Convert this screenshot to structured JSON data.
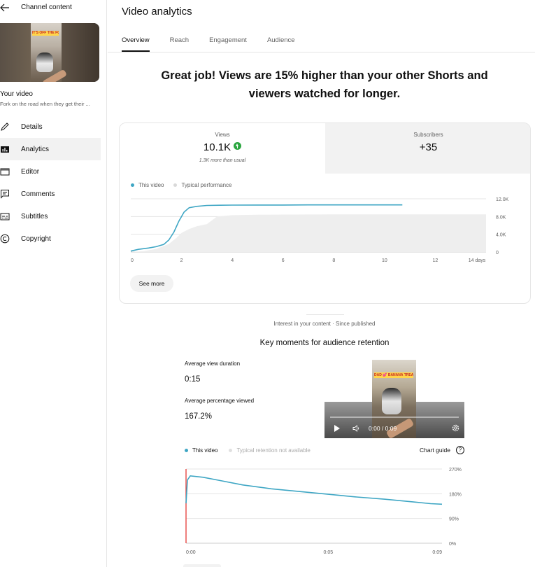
{
  "sidebar": {
    "title": "Channel content",
    "thumbnail_caption": "IT'S OFF THE FORK IN THE ROAD",
    "your_video_label": "Your video",
    "video_title": "Fork on the road when they get their ...",
    "items": [
      {
        "label": "Details",
        "icon": "pencil-icon"
      },
      {
        "label": "Analytics",
        "icon": "analytics-icon"
      },
      {
        "label": "Editor",
        "icon": "editor-icon"
      },
      {
        "label": "Comments",
        "icon": "comments-icon"
      },
      {
        "label": "Subtitles",
        "icon": "subtitles-icon"
      },
      {
        "label": "Copyright",
        "icon": "copyright-icon"
      }
    ],
    "active_item": "Analytics"
  },
  "header": {
    "title": "Video analytics",
    "tabs": [
      "Overview",
      "Reach",
      "Engagement",
      "Audience"
    ],
    "active_tab": "Overview"
  },
  "headline": {
    "line1": "Great job! Views are 15% higher than your other Shorts and",
    "line2": "viewers watched for longer."
  },
  "metrics": {
    "views": {
      "label": "Views",
      "value": "10.1K",
      "note": "1.3K more than usual"
    },
    "subscribers": {
      "label": "Subscribers",
      "value": "+35"
    }
  },
  "performance_chart": {
    "legend_this": "This video",
    "legend_typical": "Typical performance",
    "see_more": "See more"
  },
  "retention": {
    "interest_label": "Interest in your content · Since published",
    "title": "Key moments for audience retention",
    "avg_view_duration_label": "Average view duration",
    "avg_view_duration_value": "0:15",
    "avg_pct_label": "Average percentage viewed",
    "avg_pct_value": "167.2%",
    "legend_this": "This video",
    "legend_typical": "Typical retention not available",
    "chart_guide": "Chart guide",
    "player_time": "0:00 / 0:09",
    "player_caption": "DAD 💕 BANANA TREATS"
  },
  "colors": {
    "accent_teal": "#3ea6c4",
    "typical_fill": "#eeeeee",
    "marker_red": "#e53935",
    "positive_green": "#2ba640"
  },
  "chart_data": [
    {
      "type": "line",
      "title": "",
      "x_ticks": [
        "0",
        "2",
        "4",
        "6",
        "8",
        "10",
        "12",
        "14 days"
      ],
      "y_ticks": [
        "0",
        "4.0K",
        "8.0K",
        "12.0K"
      ],
      "xlim": [
        0,
        14
      ],
      "ylim": [
        0,
        12000
      ],
      "series": [
        {
          "name": "This video",
          "kind": "line",
          "color": "#3ea6c4",
          "x": [
            0,
            0.3,
            0.7,
            1.0,
            1.3,
            1.5,
            1.7,
            1.9,
            2.1,
            2.3,
            2.6,
            3.0,
            3.5,
            4.0,
            5.0,
            6.0,
            7.0,
            8.0,
            9.0,
            10.0,
            10.7
          ],
          "y": [
            200,
            600,
            900,
            1200,
            1700,
            2700,
            4500,
            7000,
            9000,
            10000,
            10300,
            10500,
            10550,
            10580,
            10600,
            10600,
            10620,
            10620,
            10620,
            10620,
            10620
          ]
        },
        {
          "name": "Typical performance",
          "kind": "area",
          "color": "#eeeeee",
          "x": [
            0,
            0.5,
            1.0,
            1.5,
            1.8,
            2.0,
            2.3,
            2.6,
            3.0,
            3.4,
            4.0,
            5.0,
            6.0,
            8.0,
            10.0,
            12.0,
            14.0
          ],
          "y": [
            0,
            200,
            700,
            1800,
            3200,
            4300,
            5200,
            5800,
            6300,
            8000,
            8300,
            8400,
            8450,
            8500,
            8500,
            8500,
            8500
          ]
        }
      ]
    },
    {
      "type": "line",
      "title": "Key moments for audience retention",
      "x_ticks": [
        "0:00",
        "0:05",
        "0:09"
      ],
      "y_ticks": [
        "0%",
        "90%",
        "180%",
        "270%"
      ],
      "xlim": [
        0,
        9
      ],
      "ylim": [
        0,
        270
      ],
      "series": [
        {
          "name": "This video",
          "color": "#3ea6c4",
          "x": [
            0,
            0.05,
            0.15,
            0.6,
            1.2,
            2.0,
            3.0,
            4.0,
            5.0,
            6.0,
            7.0,
            8.0,
            8.6,
            9.0
          ],
          "y": [
            145,
            230,
            245,
            240,
            228,
            212,
            198,
            188,
            178,
            168,
            160,
            150,
            144,
            142
          ]
        }
      ]
    }
  ]
}
